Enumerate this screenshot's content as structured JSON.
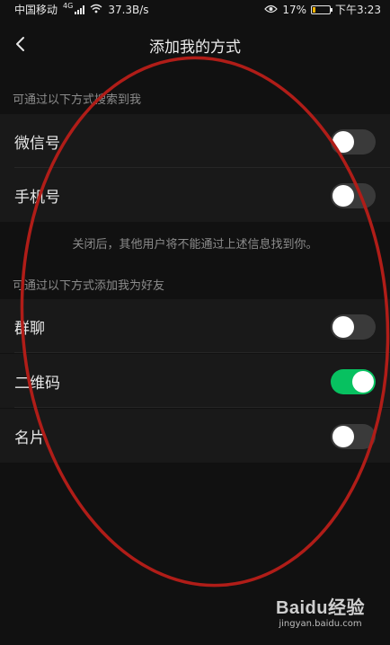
{
  "status_bar": {
    "carrier": "中国移动",
    "network_type": "4G",
    "speed": "37.3B/s",
    "battery_percent": "17%",
    "time": "下午3:23",
    "battery_level": 0.17,
    "battery_color": "#f2b200"
  },
  "nav": {
    "title": "添加我的方式",
    "back_icon": "chevron-left-icon"
  },
  "section_search": {
    "header": "可通过以下方式搜索到我",
    "items": [
      {
        "label": "微信号",
        "enabled": false
      },
      {
        "label": "手机号",
        "enabled": false
      }
    ],
    "note": "关闭后，其他用户将不能通过上述信息找到你。"
  },
  "section_add": {
    "header": "可通过以下方式添加我为好友",
    "items": [
      {
        "label": "群聊",
        "enabled": false
      },
      {
        "label": "二维码",
        "enabled": true
      },
      {
        "label": "名片",
        "enabled": false
      }
    ]
  },
  "colors": {
    "toggle_on": "#07c160",
    "toggle_off": "#3a3a3a",
    "annotation_ellipse": "#b01d18"
  },
  "watermark": {
    "brand": "Baidu经验",
    "url": "jingyan.baidu.com"
  }
}
